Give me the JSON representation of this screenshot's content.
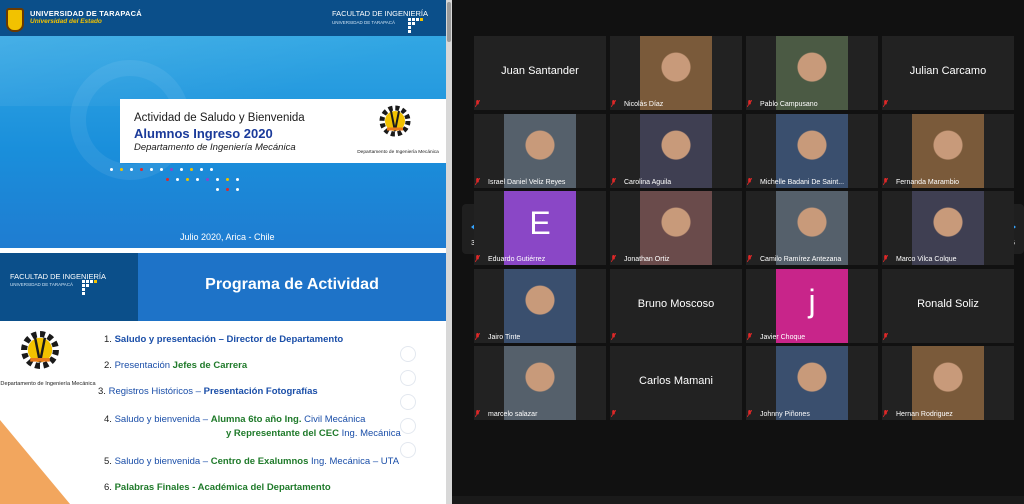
{
  "slide1": {
    "university": "UNIVERSIDAD DE TARAPACÁ",
    "university_sub": "Universidad del Estado",
    "faculty": "FACULTAD DE INGENIERÍA",
    "faculty_sub": "UNIVERSIDAD DE TARAPACÁ",
    "title_line1": "Actividad de Saludo y Bienvenida",
    "title_line2": "Alumnos Ingreso 2020",
    "title_line3": "Departamento de Ingeniería Mecánica",
    "logo_caption": "Departamento de Ingeniería Mecánica",
    "date": "Julio 2020, Arica - Chile"
  },
  "slide2": {
    "faculty": "FACULTAD DE INGENIERÍA",
    "faculty_sub": "UNIVERSIDAD DE TARAPACÁ",
    "title": "Programa de Actividad",
    "logo_caption": "Departamento de Ingeniería Mecánica",
    "items": [
      {
        "num": "1.",
        "a": "Saludo y presentación",
        "b": " – Director de Departamento"
      },
      {
        "num": "2.",
        "a": "Presentación ",
        "b": "Jefes de Carrera"
      },
      {
        "num": "3.",
        "a": "Registros Históricos – ",
        "b": "Presentación Fotografías"
      },
      {
        "num": "4.",
        "a": "Saludo y bienvenida – ",
        "b": "Alumna 6to año Ing. ",
        "c": "Civil Mecánica"
      },
      {
        "num": "",
        "a": "",
        "b": "y Representante del CEC ",
        "c": "Ing. Mecánica"
      },
      {
        "num": "5.",
        "a": "Saludo y bienvenida – ",
        "b": "Centro de Exalumnos ",
        "c": "Ing. Mecánica – UTA"
      },
      {
        "num": "6.",
        "a": "Palabras Finales ",
        "b": " - Académica del Departamento"
      }
    ]
  },
  "gallery": {
    "page_indicator_left": "3/5",
    "page_indicator_right": "3/5",
    "participants": [
      {
        "name": "Juan Santander",
        "video": false
      },
      {
        "name": "Nicolás Díaz",
        "video": true
      },
      {
        "name": "Pablo Campusano",
        "video": true
      },
      {
        "name": "Julian Carcamo",
        "video": false
      },
      {
        "name": "Israel Daniel Veliz Reyes",
        "video": true
      },
      {
        "name": "Carolina Aguila",
        "video": true
      },
      {
        "name": "Michelle Badani De Saint...",
        "video": true
      },
      {
        "name": "Fernanda Marambio",
        "video": true
      },
      {
        "name": "Eduardo Gutiérrez",
        "video": false,
        "avatar_letter": "E"
      },
      {
        "name": "Jonathan Ortiz",
        "video": true
      },
      {
        "name": "Camilo Ramírez Antezana",
        "video": true
      },
      {
        "name": "Marco Vilca Colque",
        "video": true
      },
      {
        "name": "Jairo Tinte",
        "video": true
      },
      {
        "name": "Bruno Moscoso",
        "video": false
      },
      {
        "name": "Javier Choque",
        "video": false,
        "avatar_letter": "j"
      },
      {
        "name": "Ronald Soliz",
        "video": false
      },
      {
        "name": "marcelo salazar",
        "video": true
      },
      {
        "name": "Carlos Mamani",
        "video": false
      },
      {
        "name": "Johnny Piñones",
        "video": true
      },
      {
        "name": "Hernan Rodriguez",
        "video": true
      }
    ]
  },
  "colors": {
    "mic_muted": "#e02828",
    "pager_arrow": "#35a4ff",
    "avatar_purple": "#8a47c6",
    "avatar_magenta": "#c8258a"
  },
  "icons": [
    "muted-mic-icon",
    "pager-left-arrow-icon",
    "pager-right-arrow-icon"
  ]
}
